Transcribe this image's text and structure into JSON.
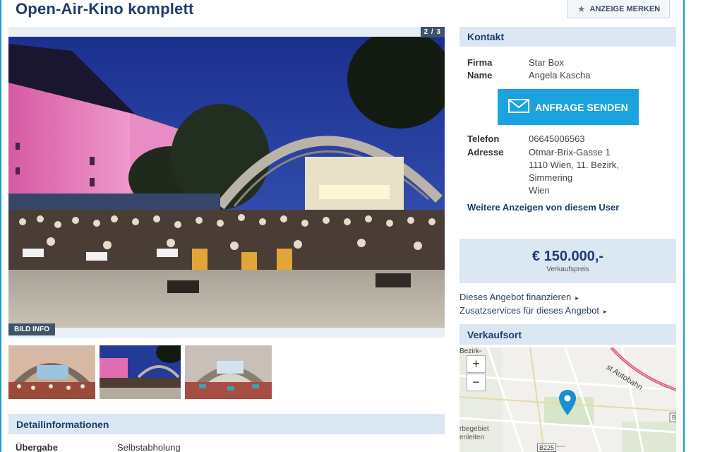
{
  "page": {
    "title": "Open-Air-Kino komplett",
    "save_label": "ANZEIGE MERKEN"
  },
  "gallery": {
    "counter": "2 / 3",
    "bild_info": "BILD INFO"
  },
  "details": {
    "heading": "Detailinformationen",
    "rows": [
      {
        "key": "Übergabe",
        "value": "Selbstabholung"
      }
    ]
  },
  "contact": {
    "heading": "Kontakt",
    "firma_label": "Firma",
    "firma": "Star Box",
    "name_label": "Name",
    "name": "Angela Kascha",
    "send_label": "ANFRAGE SENDEN",
    "telefon_label": "Telefon",
    "telefon": "06645006563",
    "adresse_label": "Adresse",
    "adresse_lines": [
      "Otmar-Brix-Gasse 1",
      "1110 Wien, 11. Bezirk,",
      "Simmering",
      "Wien"
    ],
    "more_ads": "Weitere Anzeigen von diesem User"
  },
  "price": {
    "value": "€ 150.000,-",
    "label": "Verkaufspreis"
  },
  "services": {
    "finance": "Dieses Angebot finanzieren",
    "extra": "Zusatzservices für dieses Angebot"
  },
  "location": {
    "heading": "Verkaufsort",
    "map_labels": {
      "bezirk": "Bezirk-",
      "autobahn": "st Autobahn",
      "gebiet1": "rbegebiet",
      "gebiet2": "enleiten",
      "road": "B225"
    },
    "zoom_in": "+",
    "zoom_out": "−"
  },
  "colors": {
    "brand_blue": "#1d3c6e",
    "accent": "#1ba3e0",
    "section_bg": "#dbe7f3"
  },
  "icons": {
    "save": "star-icon",
    "send": "envelope-icon",
    "pin": "map-pin-icon"
  }
}
